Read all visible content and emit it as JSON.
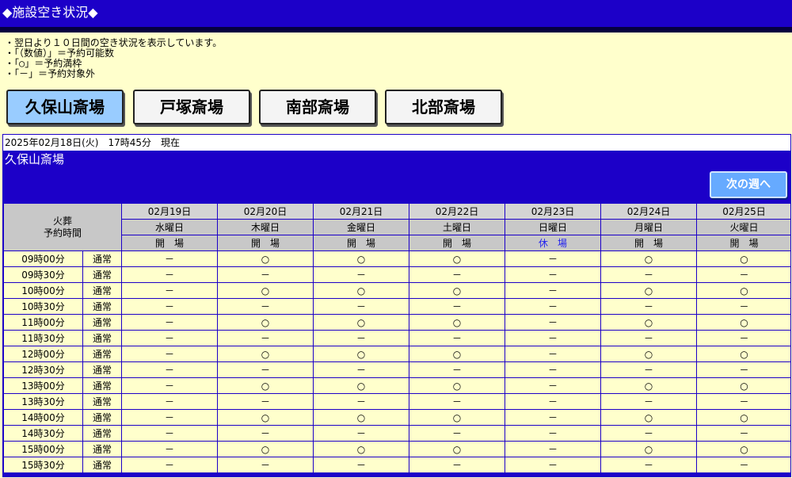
{
  "header": {
    "title": "◆施設空き状況◆"
  },
  "notes": [
    "・翌日より１０日間の空き状況を表示しています。",
    "・「（数値）」＝予約可能数",
    "・「○」＝予約満枠",
    "・「－」＝予約対象外"
  ],
  "tabs": [
    "久保山斎場",
    "戸塚斎場",
    "南部斎場",
    "北部斎場"
  ],
  "panel": {
    "date_text": "2025年02月18日(火)　17時45分　現在",
    "facility_name": "久保山斎場",
    "next_button": "次の週へ",
    "corner_line1": "火葬",
    "corner_line2": "予約時間",
    "days": [
      {
        "date": "02月19日",
        "weekday": "水曜日",
        "status": "開　場"
      },
      {
        "date": "02月20日",
        "weekday": "木曜日",
        "status": "開　場"
      },
      {
        "date": "02月21日",
        "weekday": "金曜日",
        "status": "開　場"
      },
      {
        "date": "02月22日",
        "weekday": "土曜日",
        "status": "開　場"
      },
      {
        "date": "02月23日",
        "weekday": "日曜日",
        "status": "休　場"
      },
      {
        "date": "02月24日",
        "weekday": "月曜日",
        "status": "開　場"
      },
      {
        "date": "02月25日",
        "weekday": "火曜日",
        "status": "開　場"
      }
    ],
    "rows": [
      {
        "time": "09時00分",
        "type": "通常",
        "cells": [
          "－",
          "○",
          "○",
          "○",
          "－",
          "○",
          "○"
        ]
      },
      {
        "time": "09時30分",
        "type": "通常",
        "cells": [
          "－",
          "－",
          "－",
          "－",
          "－",
          "－",
          "－"
        ]
      },
      {
        "time": "10時00分",
        "type": "通常",
        "cells": [
          "－",
          "○",
          "○",
          "○",
          "－",
          "○",
          "○"
        ]
      },
      {
        "time": "10時30分",
        "type": "通常",
        "cells": [
          "－",
          "－",
          "－",
          "－",
          "－",
          "－",
          "－"
        ]
      },
      {
        "time": "11時00分",
        "type": "通常",
        "cells": [
          "－",
          "○",
          "○",
          "○",
          "－",
          "○",
          "○"
        ]
      },
      {
        "time": "11時30分",
        "type": "通常",
        "cells": [
          "－",
          "－",
          "－",
          "－",
          "－",
          "－",
          "－"
        ]
      },
      {
        "time": "12時00分",
        "type": "通常",
        "cells": [
          "－",
          "○",
          "○",
          "○",
          "－",
          "○",
          "○"
        ]
      },
      {
        "time": "12時30分",
        "type": "通常",
        "cells": [
          "－",
          "－",
          "－",
          "－",
          "－",
          "－",
          "－"
        ]
      },
      {
        "time": "13時00分",
        "type": "通常",
        "cells": [
          "－",
          "○",
          "○",
          "○",
          "－",
          "○",
          "○"
        ]
      },
      {
        "time": "13時30分",
        "type": "通常",
        "cells": [
          "－",
          "－",
          "－",
          "－",
          "－",
          "－",
          "－"
        ]
      },
      {
        "time": "14時00分",
        "type": "通常",
        "cells": [
          "－",
          "○",
          "○",
          "○",
          "－",
          "○",
          "○"
        ]
      },
      {
        "time": "14時30分",
        "type": "通常",
        "cells": [
          "－",
          "－",
          "－",
          "－",
          "－",
          "－",
          "－"
        ]
      },
      {
        "time": "15時00分",
        "type": "通常",
        "cells": [
          "－",
          "○",
          "○",
          "○",
          "－",
          "○",
          "○"
        ]
      },
      {
        "time": "15時30分",
        "type": "通常",
        "cells": [
          "－",
          "－",
          "－",
          "－",
          "－",
          "－",
          "－"
        ]
      }
    ]
  }
}
